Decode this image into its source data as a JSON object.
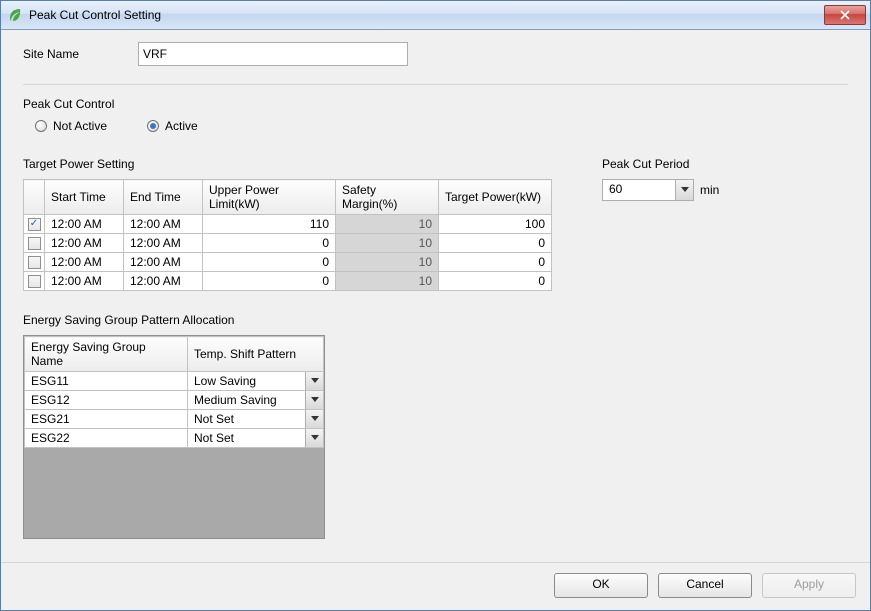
{
  "window": {
    "title": "Peak Cut Control Setting"
  },
  "siteName": {
    "label": "Site Name",
    "value": "VRF"
  },
  "peakCutControl": {
    "label": "Peak Cut Control",
    "options": {
      "notActive": "Not Active",
      "active": "Active"
    },
    "selected": "active"
  },
  "targetPowerSetting": {
    "label": "Target Power Setting",
    "headers": {
      "startTime": "Start Time",
      "endTime": "End Time",
      "upperPowerLimit": "Upper Power Limit(kW)",
      "safetyMargin": "Safety Margin(%)",
      "targetPower": "Target Power(kW)"
    },
    "rows": [
      {
        "checked": true,
        "start": "12:00 AM",
        "end": "12:00 AM",
        "upl": "110",
        "sm": "10",
        "tp": "100"
      },
      {
        "checked": false,
        "start": "12:00 AM",
        "end": "12:00 AM",
        "upl": "0",
        "sm": "10",
        "tp": "0"
      },
      {
        "checked": false,
        "start": "12:00 AM",
        "end": "12:00 AM",
        "upl": "0",
        "sm": "10",
        "tp": "0"
      },
      {
        "checked": false,
        "start": "12:00 AM",
        "end": "12:00 AM",
        "upl": "0",
        "sm": "10",
        "tp": "0"
      }
    ]
  },
  "peakCutPeriod": {
    "label": "Peak Cut Period",
    "value": "60",
    "unit": "min"
  },
  "energySavingGroup": {
    "label": "Energy Saving Group Pattern Allocation",
    "headers": {
      "name": "Energy Saving Group Name",
      "pattern": "Temp. Shift Pattern"
    },
    "rows": [
      {
        "name": "ESG11",
        "pattern": "Low Saving"
      },
      {
        "name": "ESG12",
        "pattern": "Medium Saving"
      },
      {
        "name": "ESG21",
        "pattern": "Not Set"
      },
      {
        "name": "ESG22",
        "pattern": "Not Set"
      }
    ]
  },
  "buttons": {
    "ok": "OK",
    "cancel": "Cancel",
    "apply": "Apply"
  }
}
